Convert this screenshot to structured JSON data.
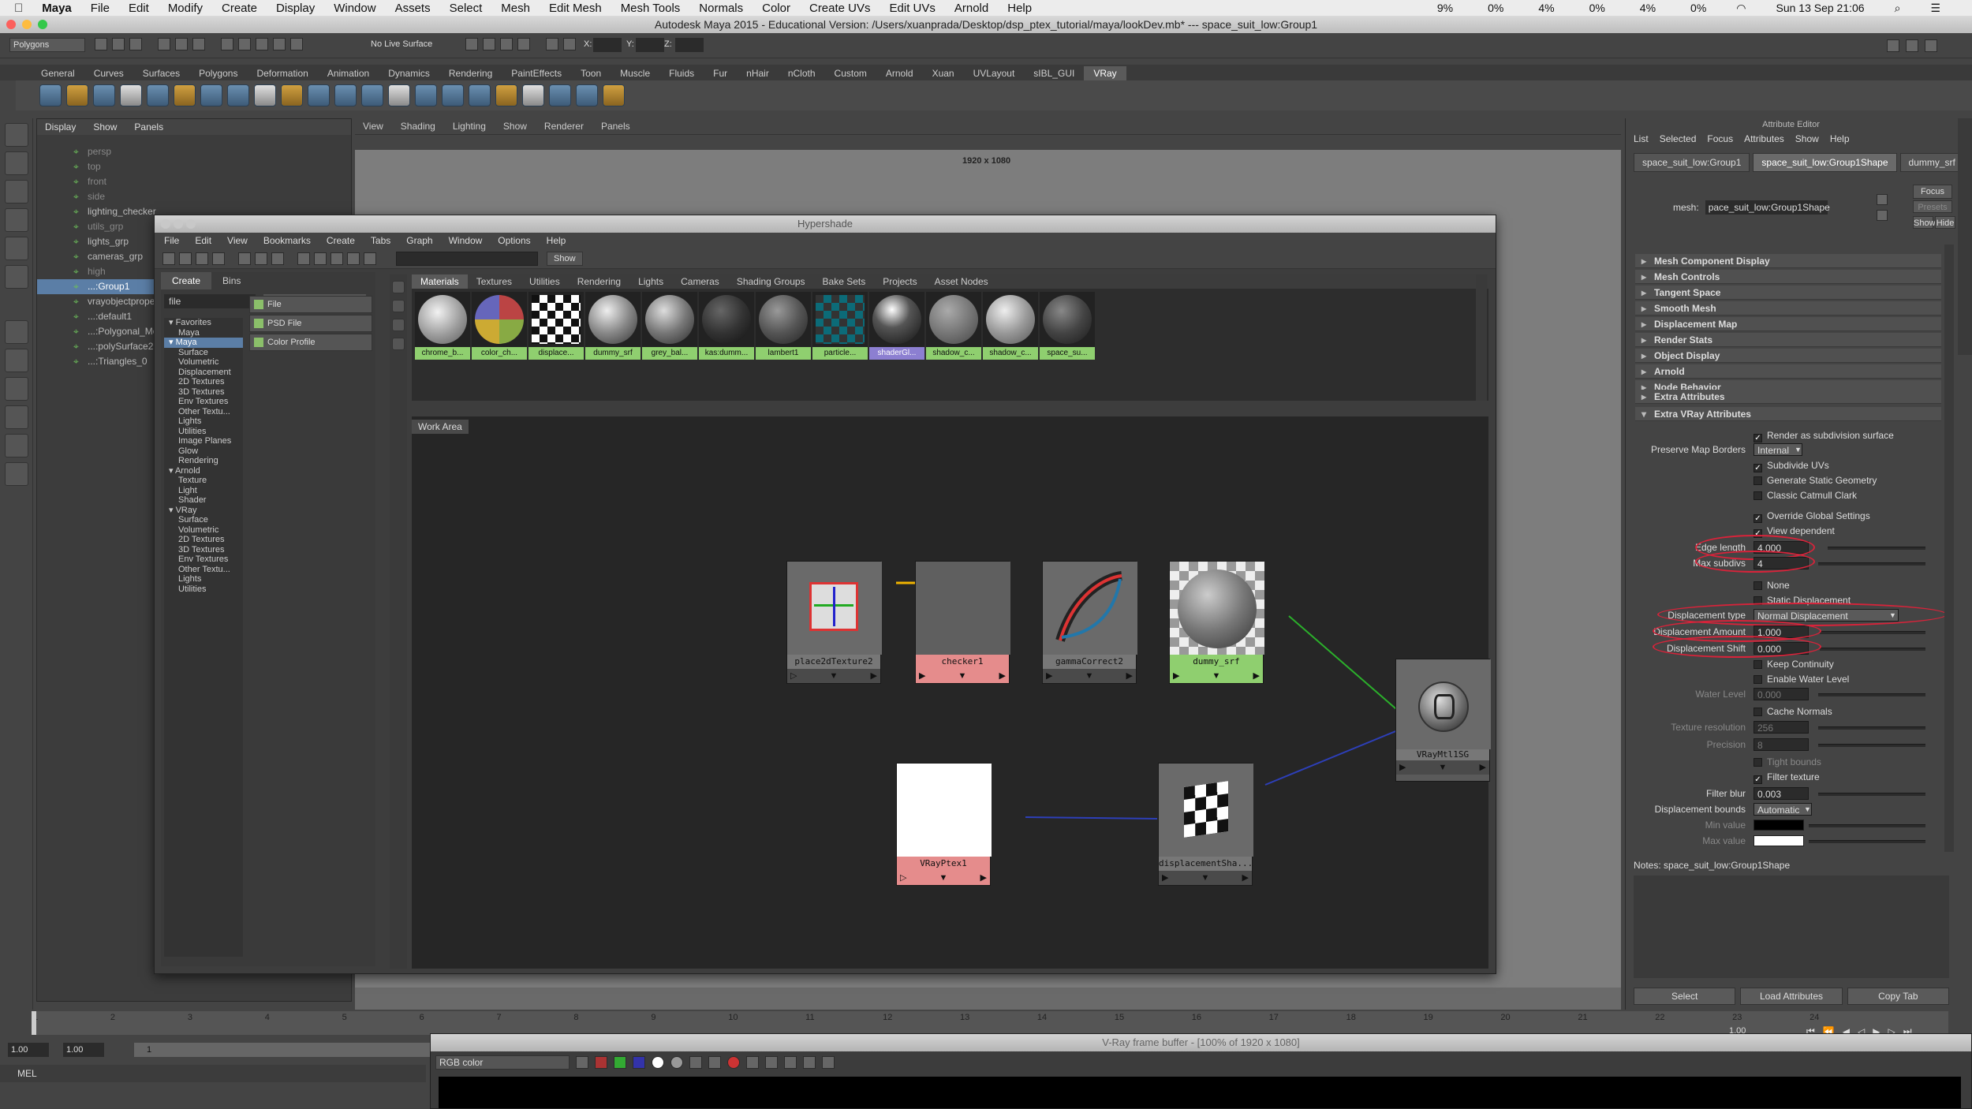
{
  "mac_menu": {
    "apple": "",
    "items": [
      "Maya",
      "File",
      "Edit",
      "Modify",
      "Create",
      "Display",
      "Window",
      "Assets",
      "Select",
      "Mesh",
      "Edit Mesh",
      "Mesh Tools",
      "Normals",
      "Color",
      "Create UVs",
      "Edit UVs",
      "Arnold",
      "Help"
    ],
    "status": [
      "9%",
      "0%",
      "4%",
      "0%",
      "4%",
      "0%"
    ],
    "clock": "Sun 13 Sep 21:06"
  },
  "window_title": "Autodesk Maya 2015 - Educational Version: /Users/xuanprada/Desktop/dsp_ptex_tutorial/maya/lookDev.mb*   ---   space_suit_low:Group1",
  "status_line": {
    "mode": "Polygons",
    "live_surface": "No Live Surface",
    "x_label": "X:",
    "y_label": "Y:",
    "z_label": "Z:"
  },
  "shelf_tabs": [
    "General",
    "Curves",
    "Surfaces",
    "Polygons",
    "Deformation",
    "Animation",
    "Dynamics",
    "Rendering",
    "PaintEffects",
    "Toon",
    "Muscle",
    "Fluids",
    "Fur",
    "nHair",
    "nCloth",
    "Custom",
    "Arnold",
    "Xuan",
    "UVLayout",
    "sIBL_GUI",
    "VRay"
  ],
  "shelf_active": "VRay",
  "outliner": {
    "menu": [
      "Display",
      "Show",
      "Panels"
    ],
    "items": [
      {
        "label": "persp",
        "dim": true
      },
      {
        "label": "top",
        "dim": true
      },
      {
        "label": "front",
        "dim": true
      },
      {
        "label": "side",
        "dim": true
      },
      {
        "label": "lighting_checker",
        "dim": false
      },
      {
        "label": "utils_grp",
        "dim": true
      },
      {
        "label": "lights_grp",
        "dim": false
      },
      {
        "label": "cameras_grp",
        "dim": false
      },
      {
        "label": "high",
        "dim": true
      },
      {
        "label": "...:Group1",
        "dim": false,
        "selected": true
      },
      {
        "label": "vrayobjectprope",
        "dim": false
      },
      {
        "label": "...:default1",
        "dim": false
      },
      {
        "label": "...:Polygonal_Mo",
        "dim": false
      },
      {
        "label": "...:polySurface2",
        "dim": false
      },
      {
        "label": "...:Triangles_0",
        "dim": false
      }
    ]
  },
  "viewport": {
    "menu": [
      "View",
      "Shading",
      "Lighting",
      "Show",
      "Renderer",
      "Panels"
    ],
    "resolution": "1920 x 1080"
  },
  "hypershade": {
    "title": "Hypershade",
    "menu": [
      "File",
      "Edit",
      "View",
      "Bookmarks",
      "Create",
      "Tabs",
      "Graph",
      "Window",
      "Options",
      "Help"
    ],
    "show_button": "Show",
    "left_tabs": [
      "Create",
      "Bins"
    ],
    "filter_value": "file",
    "categories": [
      {
        "label": "Favorites",
        "head": true
      },
      {
        "label": "Maya"
      },
      {
        "label": "Maya",
        "head": true,
        "selected": true
      },
      {
        "label": "Surface"
      },
      {
        "label": "Volumetric"
      },
      {
        "label": "Displacement"
      },
      {
        "label": "2D Textures"
      },
      {
        "label": "3D Textures"
      },
      {
        "label": "Env Textures"
      },
      {
        "label": "Other Textu..."
      },
      {
        "label": "Lights"
      },
      {
        "label": "Utilities"
      },
      {
        "label": "Image Planes"
      },
      {
        "label": "Glow"
      },
      {
        "label": "Rendering"
      },
      {
        "label": "Arnold",
        "head": true
      },
      {
        "label": "Texture"
      },
      {
        "label": "Light"
      },
      {
        "label": "Shader"
      },
      {
        "label": "VRay",
        "head": true
      },
      {
        "label": "Surface"
      },
      {
        "label": "Volumetric"
      },
      {
        "label": "2D Textures"
      },
      {
        "label": "3D Textures"
      },
      {
        "label": "Env Textures"
      },
      {
        "label": "Other Textu..."
      },
      {
        "label": "Lights"
      },
      {
        "label": "Utilities"
      }
    ],
    "types": [
      "File",
      "PSD File",
      "Color Profile"
    ],
    "swatch_tabs": [
      "Materials",
      "Textures",
      "Utilities",
      "Rendering",
      "Lights",
      "Cameras",
      "Shading Groups",
      "Bake Sets",
      "Projects",
      "Asset Nodes"
    ],
    "swatch_active": "Materials",
    "swatches": [
      {
        "label": "chrome_b...",
        "fill": "radial-gradient(circle at 40% 35%, #f2f2f2, #9a9a9a 55%, #5a5a5a)"
      },
      {
        "label": "color_ch...",
        "fill": "conic-gradient(#b44 0 25%, #8a4 0 50%, #ca3 0 75%, #66b 0)"
      },
      {
        "label": "displace...",
        "fill": "repeating-conic-gradient(#fff 0 25%, #111 0 50%)"
      },
      {
        "label": "dummy_srf",
        "fill": "radial-gradient(circle at 38% 32%, #eee, #888 50%, #333)"
      },
      {
        "label": "grey_bal...",
        "fill": "radial-gradient(circle at 38% 32%, #ddd, #777 50%, #2a2a2a)"
      },
      {
        "label": "kas:dumm...",
        "fill": "radial-gradient(circle at 38% 32%, #666, #333 50%, #111)"
      },
      {
        "label": "lambert1",
        "fill": "radial-gradient(circle at 38% 32%, #999, #555 50%, #222)"
      },
      {
        "label": "particle...",
        "fill": "repeating-conic-gradient(#0c6b78 0 25%, #333 0 50%)"
      },
      {
        "label": "shaderGl...",
        "fill": "radial-gradient(circle at 40% 30%, #fff, #555 40%, #111)",
        "selected": true
      },
      {
        "label": "shadow_c...",
        "fill": "radial-gradient(circle at 38% 32%, #aaa, #777 50%, #444)"
      },
      {
        "label": "shadow_c...",
        "fill": "radial-gradient(circle at 38% 32%, #eee, #999 50%, #555)"
      },
      {
        "label": "space_su...",
        "fill": "radial-gradient(circle at 38% 32%, #888, #444 50%, #1a1a1a)"
      }
    ],
    "work_area_tab": "Work Area",
    "nodes": {
      "place2d": "place2dTexture2",
      "checker": "checker1",
      "gamma": "gammaCorrect2",
      "dummy": "dummy_srf",
      "vraymtl": "VRayMtl1SG",
      "ptex": "VRayPtex1",
      "disp": "displacementSha..."
    }
  },
  "attribute_editor": {
    "title": "Attribute Editor",
    "menu": [
      "List",
      "Selected",
      "Focus",
      "Attributes",
      "Show",
      "Help"
    ],
    "tabs": [
      "space_suit_low:Group1",
      "space_suit_low:Group1Shape",
      "dummy_srf"
    ],
    "active_tab": "space_suit_low:Group1Shape",
    "mesh_label": "mesh:",
    "mesh_value": "pace_suit_low:Group1Shape",
    "focus_btn": "Focus",
    "presets_btn": "Presets",
    "show_btn": "Show",
    "hide_btn": "Hide",
    "sections": [
      "Mesh Component Display",
      "Mesh Controls",
      "Tangent Space",
      "Smooth Mesh",
      "Displacement Map",
      "Render Stats",
      "Object Display",
      "Arnold",
      "Node Behavior"
    ],
    "extra_attrs": "Extra Attributes",
    "extra_vray": "Extra VRay Attributes",
    "render_subdiv": "Render as subdivision surface",
    "preserve_borders_label": "Preserve Map Borders",
    "preserve_borders_value": "Internal",
    "subdivide_uvs": "Subdivide UVs",
    "gen_static": "Generate Static Geometry",
    "classic_catmull": "Classic Catmull Clark",
    "override_global": "Override Global Settings",
    "view_dependent": "View dependent",
    "edge_length_label": "Edge length",
    "edge_length_value": "4.000",
    "max_subdivs_label": "Max subdivs",
    "max_subdivs_value": "4",
    "none_label": "None",
    "static_disp": "Static Displacement",
    "disp_type_label": "Displacement type",
    "disp_type_value": "Normal Displacement",
    "disp_amount_label": "Displacement Amount",
    "disp_amount_value": "1.000",
    "disp_shift_label": "Displacement Shift",
    "disp_shift_value": "0.000",
    "keep_continuity": "Keep Continuity",
    "enable_water": "Enable Water Level",
    "water_level_label": "Water Level",
    "water_level_value": "0.000",
    "cache_normals": "Cache Normals",
    "tex_res_label": "Texture resolution",
    "tex_res_value": "256",
    "precision_label": "Precision",
    "precision_value": "8",
    "tight_bounds": "Tight bounds",
    "filter_texture": "Filter texture",
    "filter_blur_label": "Filter blur",
    "filter_blur_value": "0.003",
    "disp_bounds_label": "Displacement bounds",
    "disp_bounds_value": "Automatic",
    "min_value_label": "Min value",
    "max_value_label": "Max value",
    "notes": "Notes:  space_suit_low:Group1Shape",
    "bottom": [
      "Select",
      "Load Attributes",
      "Copy Tab"
    ]
  },
  "timeline": {
    "ticks": [
      "1",
      "2",
      "3",
      "4",
      "5",
      "6",
      "7",
      "8",
      "9",
      "10",
      "11",
      "12",
      "13",
      "14",
      "15",
      "16",
      "17",
      "18",
      "19",
      "20",
      "21",
      "22",
      "23",
      "24"
    ],
    "start": "1.00",
    "start2": "1.00",
    "current": "1",
    "end": "1.00"
  },
  "mel_label": "MEL",
  "vray_fb": {
    "title": "V-Ray frame buffer - [100% of 1920 x 1080]",
    "channel": "RGB color"
  }
}
